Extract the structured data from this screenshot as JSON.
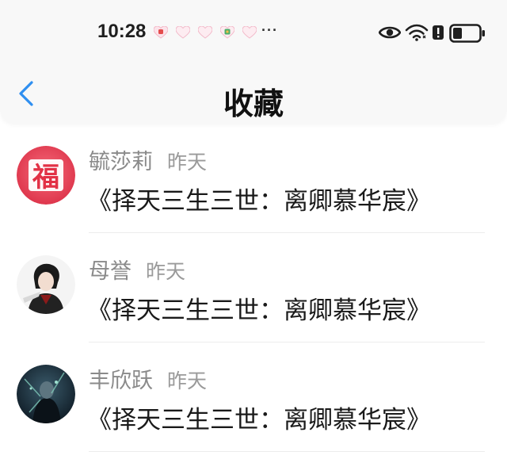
{
  "status_bar": {
    "time": "10:28",
    "more": "···",
    "battery_level": 0.35,
    "icons": [
      "notification-app-icon",
      "heart-icon",
      "heart-icon",
      "notification-app-icon",
      "heart-icon",
      "eye-icon",
      "wifi-icon",
      "alert-icon",
      "battery-icon"
    ]
  },
  "nav": {
    "title": "收藏",
    "back_icon": "chevron-left-icon",
    "accent_color": "#2f8ff0"
  },
  "favorites": [
    {
      "name": "毓莎莉",
      "time": "昨天",
      "content": "《择天三生三世：离卿慕华宸》",
      "avatar": "福"
    },
    {
      "name": "母誉",
      "time": "昨天",
      "content": "《择天三生三世：离卿慕华宸》",
      "avatar": ""
    },
    {
      "name": "丰欣跃",
      "time": "昨天",
      "content": "《择天三生三世：离卿慕华宸》",
      "avatar": ""
    }
  ]
}
